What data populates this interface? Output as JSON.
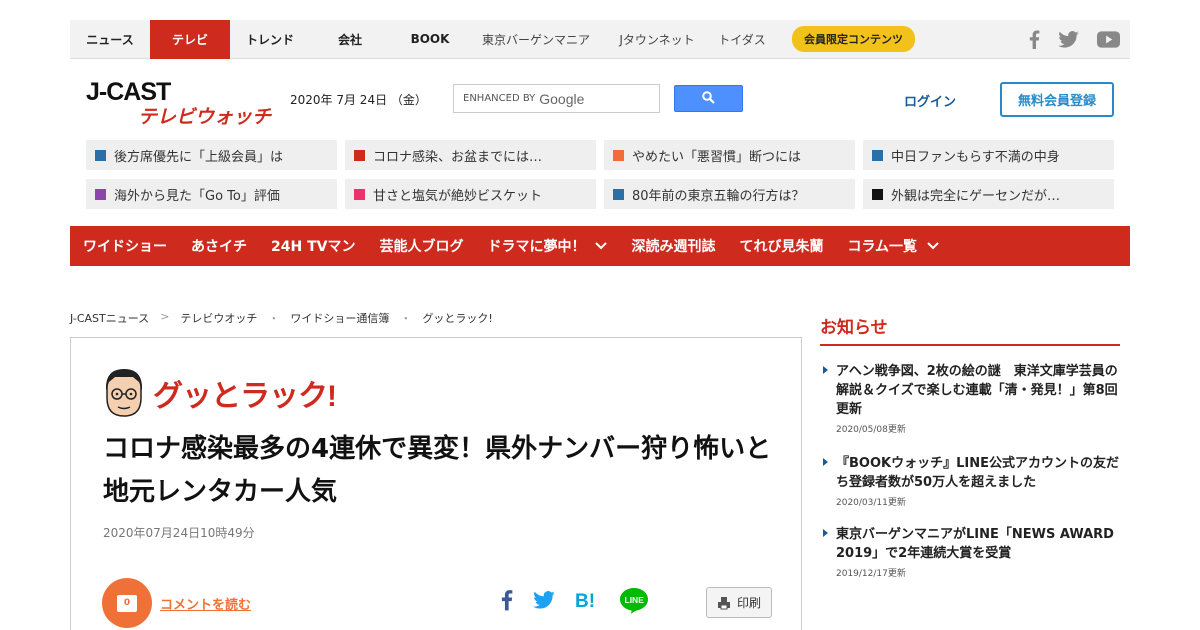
{
  "topnav": {
    "items": [
      {
        "label": "ニュース",
        "w": 80
      },
      {
        "label": "テレビ",
        "w": 80
      },
      {
        "label": "トレンド",
        "w": 80
      },
      {
        "label": "会社",
        "w": 80
      },
      {
        "label": "BOOK",
        "w": 80
      },
      {
        "label": "東京バーゲンマニア",
        "w": 132
      },
      {
        "label": "Jタウンネット",
        "w": 110
      },
      {
        "label": "トイダス",
        "w": 60
      }
    ],
    "member_label": "会員限定コンテンツ",
    "social_icons": [
      "facebook-icon",
      "twitter-icon",
      "youtube-icon"
    ]
  },
  "header": {
    "logo_main": "J-CAST",
    "logo_sub": "テレビウォッチ",
    "date": "2020年 7月 24日 （金）",
    "search_enhanced": "ENHANCED BY",
    "search_brand": "Google",
    "login": "ログイン",
    "register": "無料会員登録"
  },
  "ticker": [
    {
      "text": "後方席優先に「上級会員」は",
      "color": "#2a6fa8"
    },
    {
      "text": "コロナ感染、お盆までには…",
      "color": "#cf2a1e"
    },
    {
      "text": "やめたい「悪習慣」断つには",
      "color": "#f26b3a"
    },
    {
      "text": "中日ファンもらす不満の中身",
      "color": "#2a6fa8"
    },
    {
      "text": "海外から見た「Go To」評価",
      "color": "#8e44ad"
    },
    {
      "text": "甘さと塩気が絶妙ビスケット",
      "color": "#e8336d"
    },
    {
      "text": "80年前の東京五輪の行方は？",
      "color": "#2a6fa8"
    },
    {
      "text": "外観は完全にゲーセンだが…",
      "color": "#111111"
    }
  ],
  "rednav": [
    {
      "label": "ワイドショー",
      "dropdown": false
    },
    {
      "label": "あさイチ",
      "dropdown": false
    },
    {
      "label": "24H TVマン",
      "dropdown": false
    },
    {
      "label": "芸能人ブログ",
      "dropdown": false
    },
    {
      "label": "ドラマに夢中！",
      "dropdown": true
    },
    {
      "label": "深読み週刊誌",
      "dropdown": false
    },
    {
      "label": "てれび見朱蘭",
      "dropdown": false
    },
    {
      "label": "コラム一覧",
      "dropdown": true
    }
  ],
  "breadcrumb": [
    "J-CASTニュース",
    "テレビウオッチ",
    "ワイドショー通信簿",
    "グッとラック!"
  ],
  "breadcrumb_seps": [
    ">",
    "・",
    "・"
  ],
  "article": {
    "program": "グッとラック!",
    "headline": "コロナ感染最多の4連休で異変！県外ナンバー狩り怖いと地元レンタカー人気",
    "published": "2020年07月24日10時49分",
    "comment_count": "0",
    "comment_link": "コメントを読む",
    "print": "印刷"
  },
  "sidebar": {
    "title": "お知らせ",
    "news": [
      {
        "title": "アヘン戦争図、2枚の絵の謎　東洋文庫学芸員の解説＆クイズで楽しむ連載「清・発見！」第8回更新",
        "date": "2020/05/08更新"
      },
      {
        "title": "『BOOKウォッチ』LINE公式アカウントの友だち登録者数が50万人を超えました",
        "date": "2020/03/11更新"
      },
      {
        "title": "東京バーゲンマニアがLINE「NEWS AWARD 2019」で2年連続大賞を受賞",
        "date": "2019/12/17更新"
      }
    ]
  }
}
